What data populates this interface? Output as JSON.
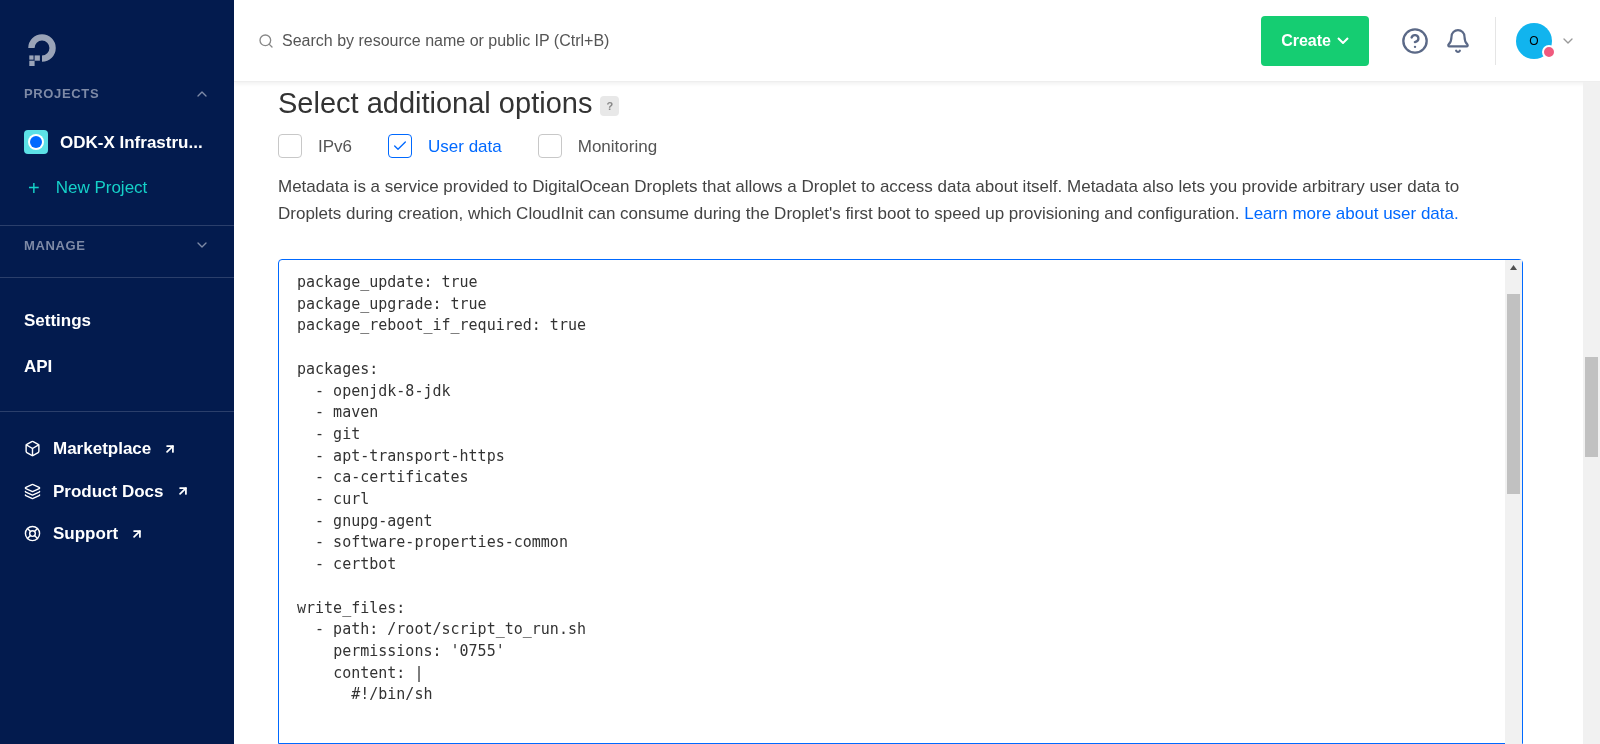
{
  "sidebar": {
    "sections": [
      {
        "title": "PROJECTS",
        "expanded": true,
        "items": [
          {
            "kind": "project",
            "label": "ODK-X Infrastru..."
          },
          {
            "kind": "new",
            "icon": "+",
            "label": "New Project"
          }
        ]
      },
      {
        "title": "MANAGE",
        "expanded": false
      }
    ],
    "links": [
      {
        "label": "Settings"
      },
      {
        "label": "API"
      }
    ],
    "external_links": [
      {
        "label": "Marketplace"
      },
      {
        "label": "Product Docs"
      },
      {
        "label": "Support"
      }
    ]
  },
  "header": {
    "search": {
      "placeholder": "Search by resource name or public IP (Ctrl+B)"
    },
    "create_button": "Create",
    "avatar": "O"
  },
  "options": {
    "title": "Select additional options",
    "help": "?",
    "checkboxes": [
      {
        "label": "IPv6",
        "checked": false
      },
      {
        "label": "User data",
        "checked": true
      },
      {
        "label": "Monitoring",
        "checked": false
      }
    ],
    "description": "Metadata is a service provided to DigitalOcean Droplets that allows a Droplet to access data about itself. Metadata also lets you provide arbitrary user data to Droplets during creation, which CloudInit can consume during the Droplet's first boot to speed up provisioning and configuration.",
    "learn_more": "Learn more about user data.",
    "user_data": [
      [
        "package_update: true",
        "package_upgrade: true",
        "package_reboot_if_required: true"
      ],
      [
        "packages:",
        "  - openjdk-8-jdk",
        "  - maven",
        "  - git",
        "  - apt-transport-https",
        "  - ca-certificates",
        "  - curl",
        "  - gnupg-agent",
        "  - software-properties-common",
        "  - certbot"
      ],
      [
        "write_files:",
        "  - path: /root/script_to_run.sh",
        "    permissions: '0755'",
        "    content: |",
        "      #!/bin/sh"
      ]
    ]
  }
}
